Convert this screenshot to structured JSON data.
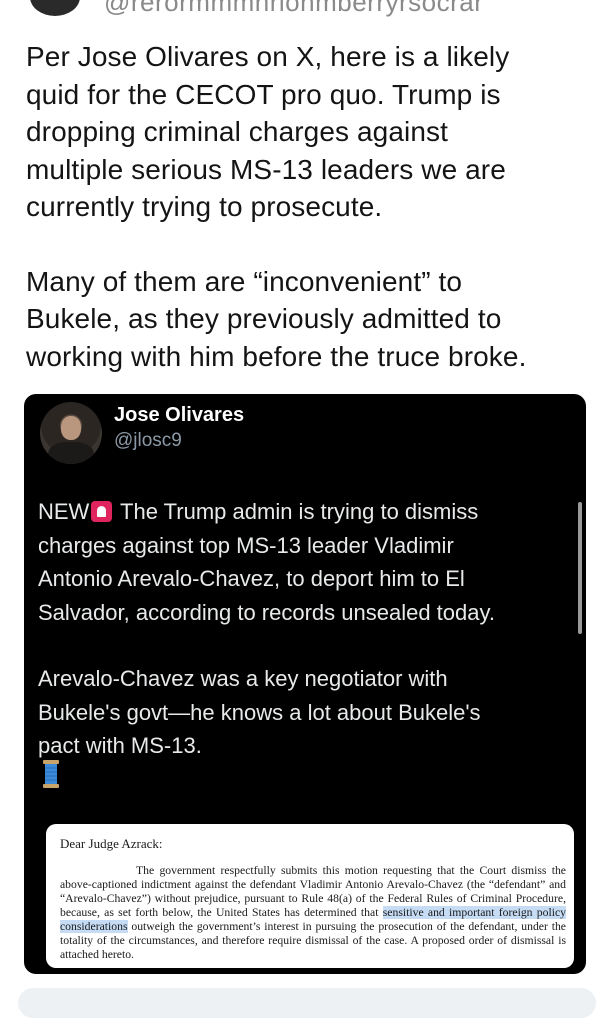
{
  "colors": {
    "background": "#ffffff",
    "card_background": "#000000",
    "card_text": "#e7e9ea",
    "card_handle": "#8b98a5",
    "highlight": "#c6dcf5"
  },
  "top": {
    "handle_fragment": "@rerormmmnrionmberryrsocrar"
  },
  "post": {
    "paragraphs": [
      "Per Jose Olivares on X, here is a likely\nquid for the CECOT pro quo. Trump is\ndropping criminal charges against\nmultiple serious MS-13 leaders we are\ncurrently trying to prosecute.",
      "Many of them are “inconvenient” to\nBukele, as they previously admitted to\nworking with him before the truce broke."
    ]
  },
  "quoted": {
    "author_name": "Jose Olivares",
    "author_handle": "@jlosc9",
    "avatar_icon": "profile-photo",
    "p1_lead": "NEW",
    "p1_emoji_icon": "rotating-light-icon",
    "p1_rest": " The Trump admin is trying to dismiss\ncharges against top MS-13 leader Vladimir\nAntonio Arevalo-Chavez, to deport him to El\nSalvador, according to records unsealed today.",
    "p2": "Arevalo-Chavez was a key negotiator with\nBukele's govt—he knows a lot about Bukele's\npact with MS-13.",
    "thread_icon": "spool-of-thread-icon"
  },
  "document": {
    "salutation": "Dear Judge Azrack:",
    "text_before": "The government respectfully submits this motion requesting that the Court dismiss the above-captioned indictment against the defendant Vladimir Antonio Arevalo-Chavez (the “defendant” and “Arevalo-Chavez”) without prejudice, pursuant to Rule 48(a) of the Federal Rules of Criminal Procedure, because, as set forth below, the United States has determined that ",
    "text_highlight": "sensitive and important foreign policy considerations",
    "text_after": " outweigh the government’s interest in pursuing the prosecution of the defendant, under the totality of the circumstances, and therefore require dismissal of the case.  A proposed order of dismissal is attached hereto."
  }
}
